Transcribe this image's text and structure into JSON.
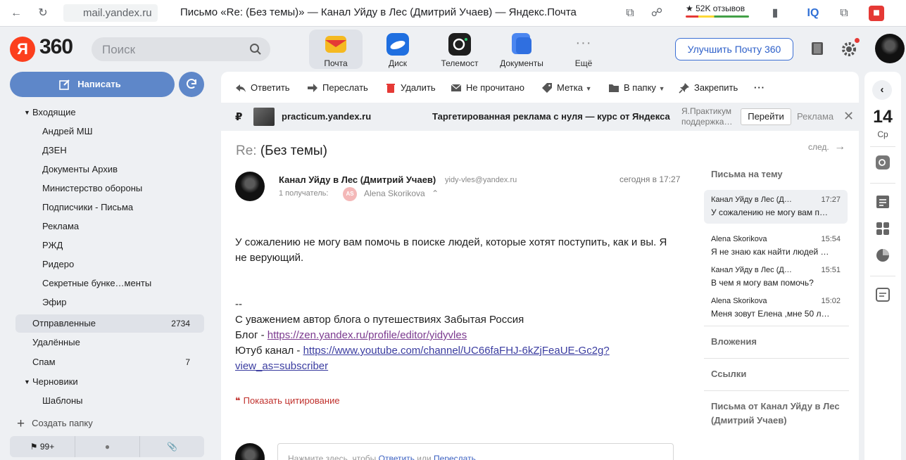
{
  "browser": {
    "url": "mail.yandex.ru",
    "title": "Письмо «Re: (Без темы)» — Канал Уйду в Лес (Дмитрий Учаев) — Яндекс.Почта",
    "reviews": "★ 52K отзывов",
    "ext_iq": "IQ"
  },
  "header": {
    "logo_ya": "Я",
    "logo_360": "360",
    "search_placeholder": "Поиск",
    "apps": [
      {
        "label": "Почта",
        "icon": "mail-icon",
        "color": "#f5b921"
      },
      {
        "label": "Диск",
        "icon": "disk-icon",
        "color": "#1f6fe0"
      },
      {
        "label": "Телемост",
        "icon": "telemost-icon",
        "color": "#1e1e1e"
      },
      {
        "label": "Документы",
        "icon": "documents-icon",
        "color": "#4b86f0"
      },
      {
        "label": "Ещё",
        "icon": "more-dots-icon",
        "color": "#8a8a8a"
      }
    ],
    "upgrade_label": "Улучшить Почту 360"
  },
  "sidebar": {
    "compose_label": "Написать",
    "inbox_label": "Входящие",
    "inbox_subfolders": [
      "Андрей МШ",
      "ДЗЕН",
      "Документы Архив",
      "Министерство обороны",
      "Подписчики - Письма",
      "Реклама",
      "РЖД",
      "Ридеро",
      "Секретные бунке…менты",
      "Эфир"
    ],
    "sent": {
      "label": "Отправленные",
      "count": "2734"
    },
    "deleted_label": "Удалённые",
    "spam": {
      "label": "Спам",
      "count": "7"
    },
    "drafts_label": "Черновики",
    "templates_label": "Шаблоны",
    "create_folder_label": "Создать папку",
    "flag_count": "99+"
  },
  "toolbar": {
    "reply": "Ответить",
    "forward": "Переслать",
    "delete": "Удалить",
    "unread": "Не прочитано",
    "label": "Метка",
    "to_folder": "В папку",
    "pin": "Закрепить",
    "more": "···"
  },
  "ad": {
    "currency": "₽",
    "domain": "practicum.yandex.ru",
    "text": "Таргетированная реклама с нуля — курс от Яндекса",
    "advertiser_line1": "Я.Практикум",
    "advertiser_line2": "поддержка…",
    "go_label": "Перейти",
    "ad_label": "Реклама"
  },
  "message": {
    "subject_re": "Re:",
    "subject": "(Без темы)",
    "next_label": "след.",
    "sender_name": "Канал Уйду в Лес (Дмитрий Учаев)",
    "sender_email": "yidy-vles@yandex.ru",
    "date": "сегодня в 17:27",
    "recipients_label": "1 получатель:",
    "recipient_initials": "AS",
    "recipient_name": "Alena Skorikova",
    "body_line1": "У сожалению не могу вам помочь в поиске людей, которые хотят поступить, как и вы. Я",
    "body_line2": "не верующий.",
    "sig_dash": "--",
    "sig_line1": "С уважением автор блога о путешествиях Забытая Россия",
    "blog_prefix": "Блог - ",
    "blog_url": "https://zen.yandex.ru/profile/editor/yidyvles",
    "youtube_prefix": "Ютуб канал - ",
    "youtube_url_1": "https://www.youtube.com/channel/UC66faFHJ-6kZjFeaUE-Gc2g?",
    "youtube_url_2": "view_as=subscriber",
    "show_quote": "Показать цитирование",
    "reply_hint_prefix": "Нажмите здесь, чтобы ",
    "reply_hint_reply": "Ответить",
    "reply_hint_or": " или ",
    "reply_hint_forward": "Переслать"
  },
  "thread": {
    "title": "Письма на тему",
    "items": [
      {
        "from": "Канал Уйду в Лес (Д…",
        "time": "17:27",
        "snippet": "У сожалению не могу вам п…"
      },
      {
        "from": "Alena Skorikova",
        "time": "15:54",
        "snippet": "Я не знаю как найти людей …"
      },
      {
        "from": "Канал Уйду в Лес (Д…",
        "time": "15:51",
        "snippet": "В чем я могу вам помочь?"
      },
      {
        "from": "Alena Skorikova",
        "time": "15:02",
        "snippet": "Меня зовут Елена ,мне 50 л…"
      }
    ],
    "attachments_label": "Вложения",
    "links_label": "Ссылки",
    "from_sender_line1": "Письма от Канал Уйду в Лес",
    "from_sender_line2": "(Дмитрий Учаев)"
  },
  "rail": {
    "date": "14",
    "day": "Ср"
  }
}
